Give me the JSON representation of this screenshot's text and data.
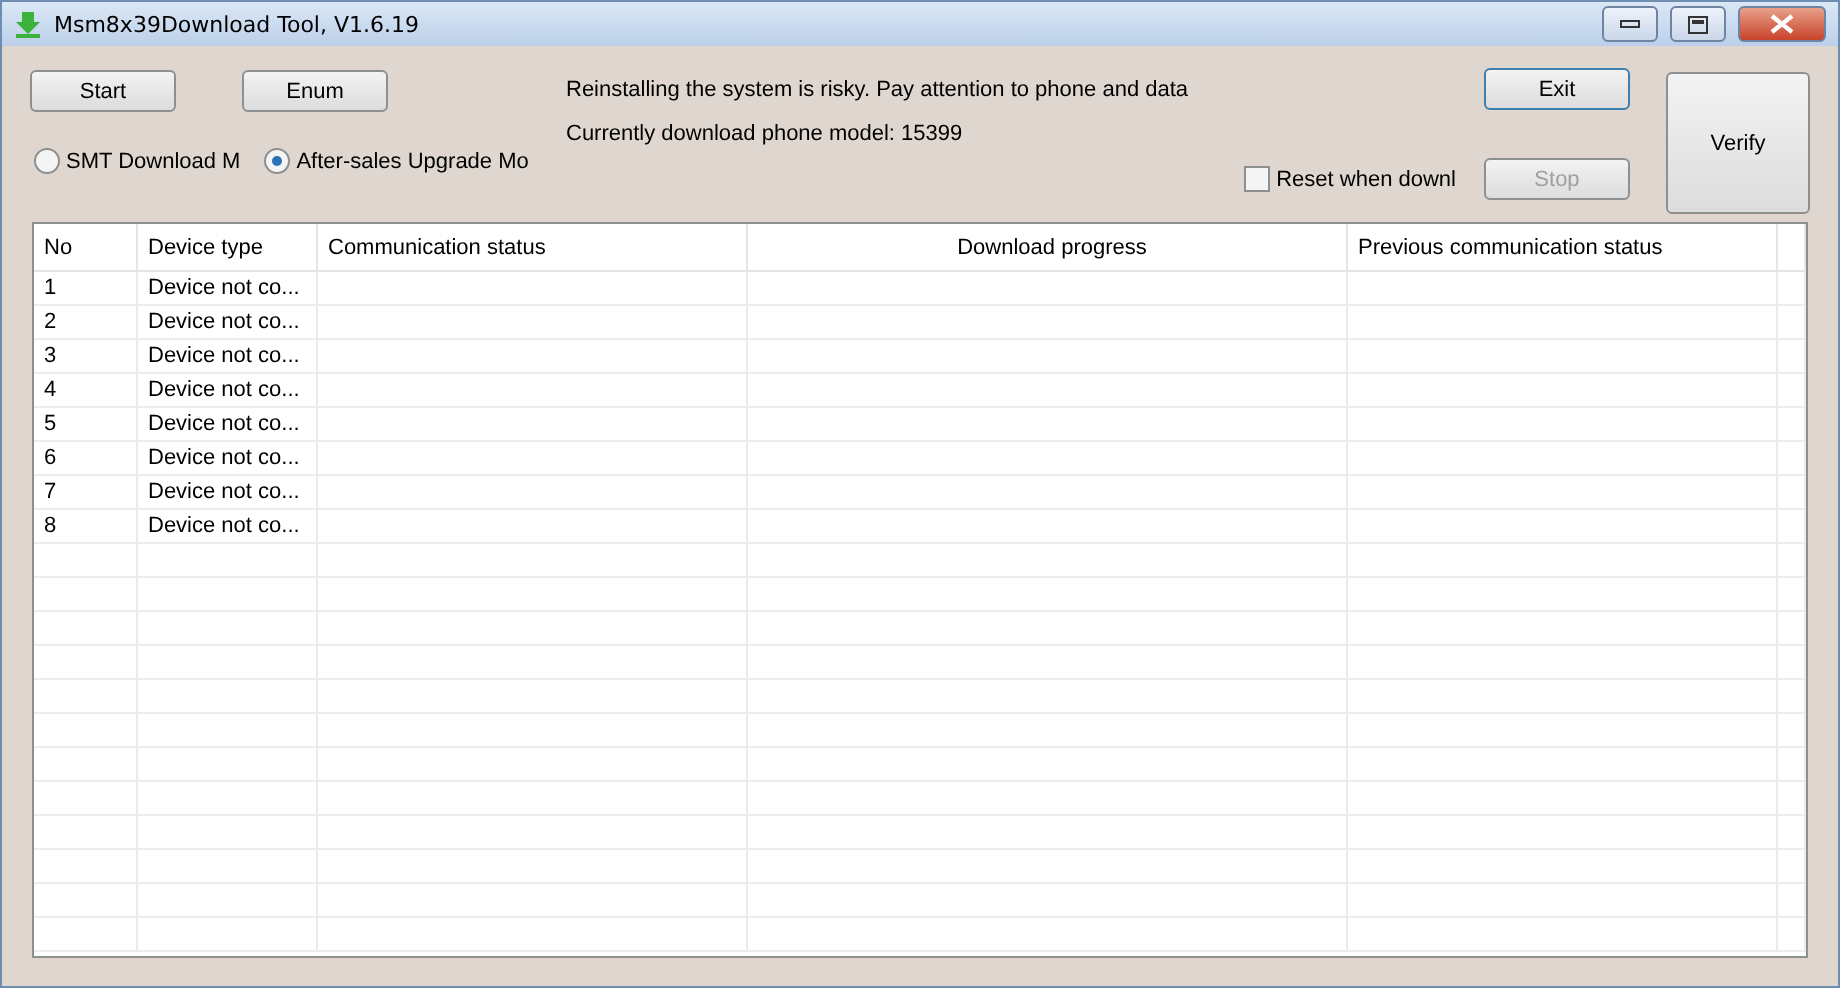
{
  "window": {
    "title": "Msm8x39Download Tool, V1.6.19"
  },
  "buttons": {
    "start": {
      "label": "Start",
      "disabled": false
    },
    "enum": {
      "label": "Enum",
      "disabled": false
    },
    "exit": {
      "label": "Exit",
      "disabled": false
    },
    "stop": {
      "label": "Stop",
      "disabled": true
    },
    "verify": {
      "label": "Verify",
      "disabled": false
    }
  },
  "messages": [
    "Reinstalling the system is risky. Pay attention to phone and data",
    "Currently download phone model: 15399"
  ],
  "modes": [
    {
      "label": "SMT Download M",
      "selected": false
    },
    {
      "label": "After-sales Upgrade Mo",
      "selected": true
    }
  ],
  "reset_option": {
    "label": "Reset when downl",
    "checked": false
  },
  "table": {
    "columns": [
      "No",
      "Device type",
      "Communication status",
      "Download progress",
      "Previous communication status"
    ],
    "rows": [
      {
        "no": "1",
        "device_type": "Device not co..."
      },
      {
        "no": "2",
        "device_type": "Device not co..."
      },
      {
        "no": "3",
        "device_type": "Device not co..."
      },
      {
        "no": "4",
        "device_type": "Device not co..."
      },
      {
        "no": "5",
        "device_type": "Device not co..."
      },
      {
        "no": "6",
        "device_type": "Device not co..."
      },
      {
        "no": "7",
        "device_type": "Device not co..."
      },
      {
        "no": "8",
        "device_type": "Device not co..."
      }
    ]
  }
}
